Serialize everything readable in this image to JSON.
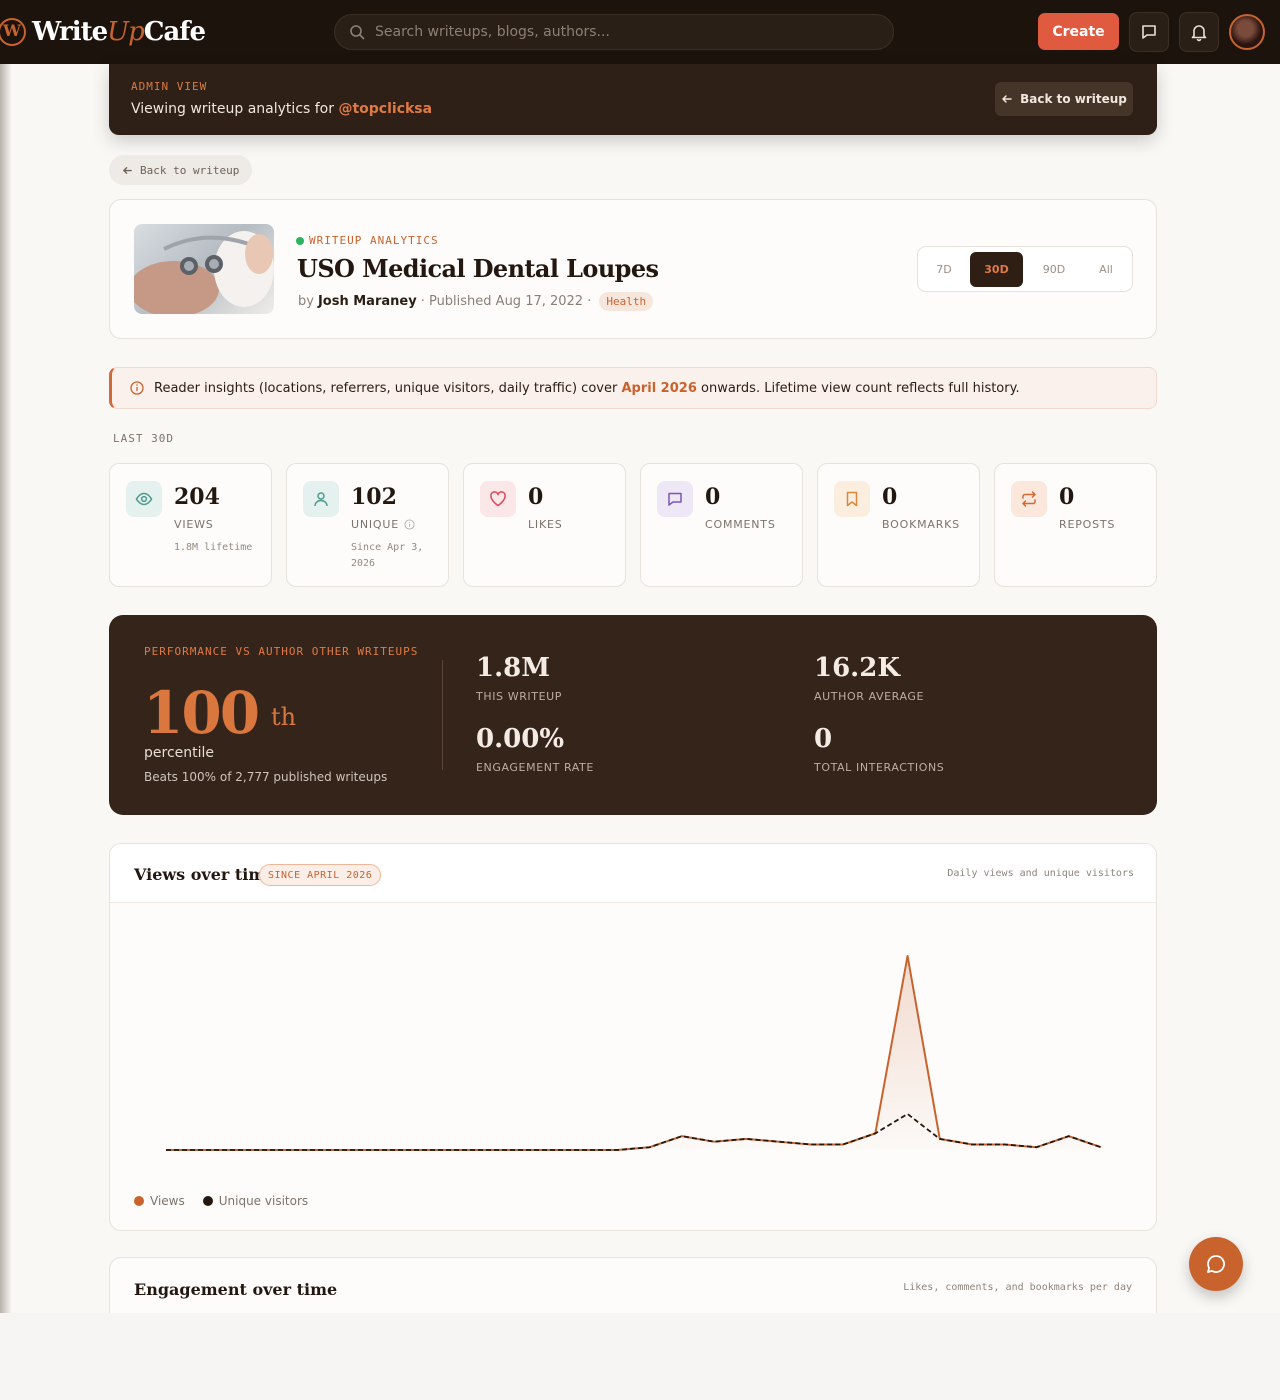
{
  "brand": {
    "name_part1": "Write",
    "name_part2": "Up",
    "name_part3": "Cafe",
    "accent": "#c8632e"
  },
  "nav": {
    "search_placeholder": "Search writeups, blogs, authors...",
    "create_label": "Create",
    "icons": [
      "messages-icon",
      "bell-icon",
      "avatar"
    ]
  },
  "admin": {
    "tag": "ADMIN VIEW",
    "line": "Viewing writeup analytics for",
    "handle": "@topclicksa",
    "back_label": "Back to writeup"
  },
  "back_pill": {
    "label": "Back to writeup"
  },
  "writeup": {
    "tag": "WRITEUP ANALYTICS",
    "title": "USO Medical Dental Loupes",
    "by": "by",
    "author": "Josh Maraney",
    "published": "· Published Aug 17, 2022 ·",
    "category": "Health"
  },
  "range": {
    "options": [
      "7D",
      "30D",
      "90D",
      "All"
    ],
    "selected": "30D"
  },
  "info": {
    "prefix": "Reader insights (locations, referrers, unique visitors, daily traffic) cover",
    "highlight": "April 2026",
    "suffix": "onwards. Lifetime view count reflects full history."
  },
  "section_label": "LAST 30D",
  "stats": [
    {
      "value": "204",
      "label": "VIEWS",
      "sub": "1.8M lifetime",
      "icon": "eye-icon",
      "color": "#4d9a8c",
      "bg": "#e5f1ee"
    },
    {
      "value": "102",
      "label": "UNIQUE",
      "sub": "Since Apr 3, 2026",
      "icon": "user-icon",
      "color": "#4d9a8c",
      "bg": "#e5f1ee"
    },
    {
      "value": "0",
      "label": "LIKES",
      "sub": "",
      "icon": "heart-icon",
      "color": "#d9485b",
      "bg": "#fbe6e8"
    },
    {
      "value": "0",
      "label": "COMMENTS",
      "sub": "",
      "icon": "comment-icon",
      "color": "#7c56b5",
      "bg": "#eee7f6"
    },
    {
      "value": "0",
      "label": "BOOKMARKS",
      "sub": "",
      "icon": "bookmark-icon",
      "color": "#d9873a",
      "bg": "#fbeedf"
    },
    {
      "value": "0",
      "label": "REPOSTS",
      "sub": "",
      "icon": "repost-icon",
      "color": "#d06a36",
      "bg": "#fbe7dc"
    }
  ],
  "performance": {
    "tag": "PERFORMANCE VS AUTHOR OTHER WRITEUPS",
    "percentile": "100",
    "suffix": "th",
    "percentile_word": "percentile",
    "beats": "Beats 100% of 2,777 published writeups",
    "metrics": [
      {
        "value": "1.8M",
        "label": "THIS WRITEUP"
      },
      {
        "value": "16.2K",
        "label": "AUTHOR AVERAGE"
      },
      {
        "value": "0.00%",
        "label": "ENGAGEMENT RATE"
      },
      {
        "value": "0",
        "label": "TOTAL INTERACTIONS"
      }
    ]
  },
  "views_chart": {
    "title": "Views over time",
    "pill": "SINCE APRIL 2026",
    "subtitle": "Daily views and unique visitors",
    "legend": [
      {
        "name": "Views",
        "color": "#c8632e"
      },
      {
        "name": "Unique visitors",
        "color": "#231710"
      }
    ]
  },
  "chart_data": {
    "type": "line",
    "title": "Views over time",
    "x": [
      1,
      2,
      3,
      4,
      5,
      6,
      7,
      8,
      9,
      10,
      11,
      12,
      13,
      14,
      15,
      16,
      17,
      18,
      19,
      20,
      21,
      22,
      23,
      24,
      25,
      26,
      27,
      28,
      29,
      30
    ],
    "series": [
      {
        "name": "Views",
        "values": [
          0,
          0,
          0,
          0,
          0,
          0,
          0,
          0,
          0,
          0,
          0,
          0,
          0,
          0,
          0,
          1,
          5,
          3,
          4,
          3,
          2,
          2,
          6,
          70,
          4,
          2,
          2,
          1,
          5,
          1
        ]
      },
      {
        "name": "Unique visitors",
        "values": [
          0,
          0,
          0,
          0,
          0,
          0,
          0,
          0,
          0,
          0,
          0,
          0,
          0,
          0,
          0,
          1,
          5,
          3,
          4,
          3,
          2,
          2,
          6,
          13,
          4,
          2,
          2,
          1,
          5,
          1
        ]
      }
    ],
    "grid": false,
    "legend_position": "bottom-left"
  },
  "engagement_chart": {
    "title": "Engagement over time",
    "subtitle": "Likes, comments, and bookmarks per day"
  }
}
